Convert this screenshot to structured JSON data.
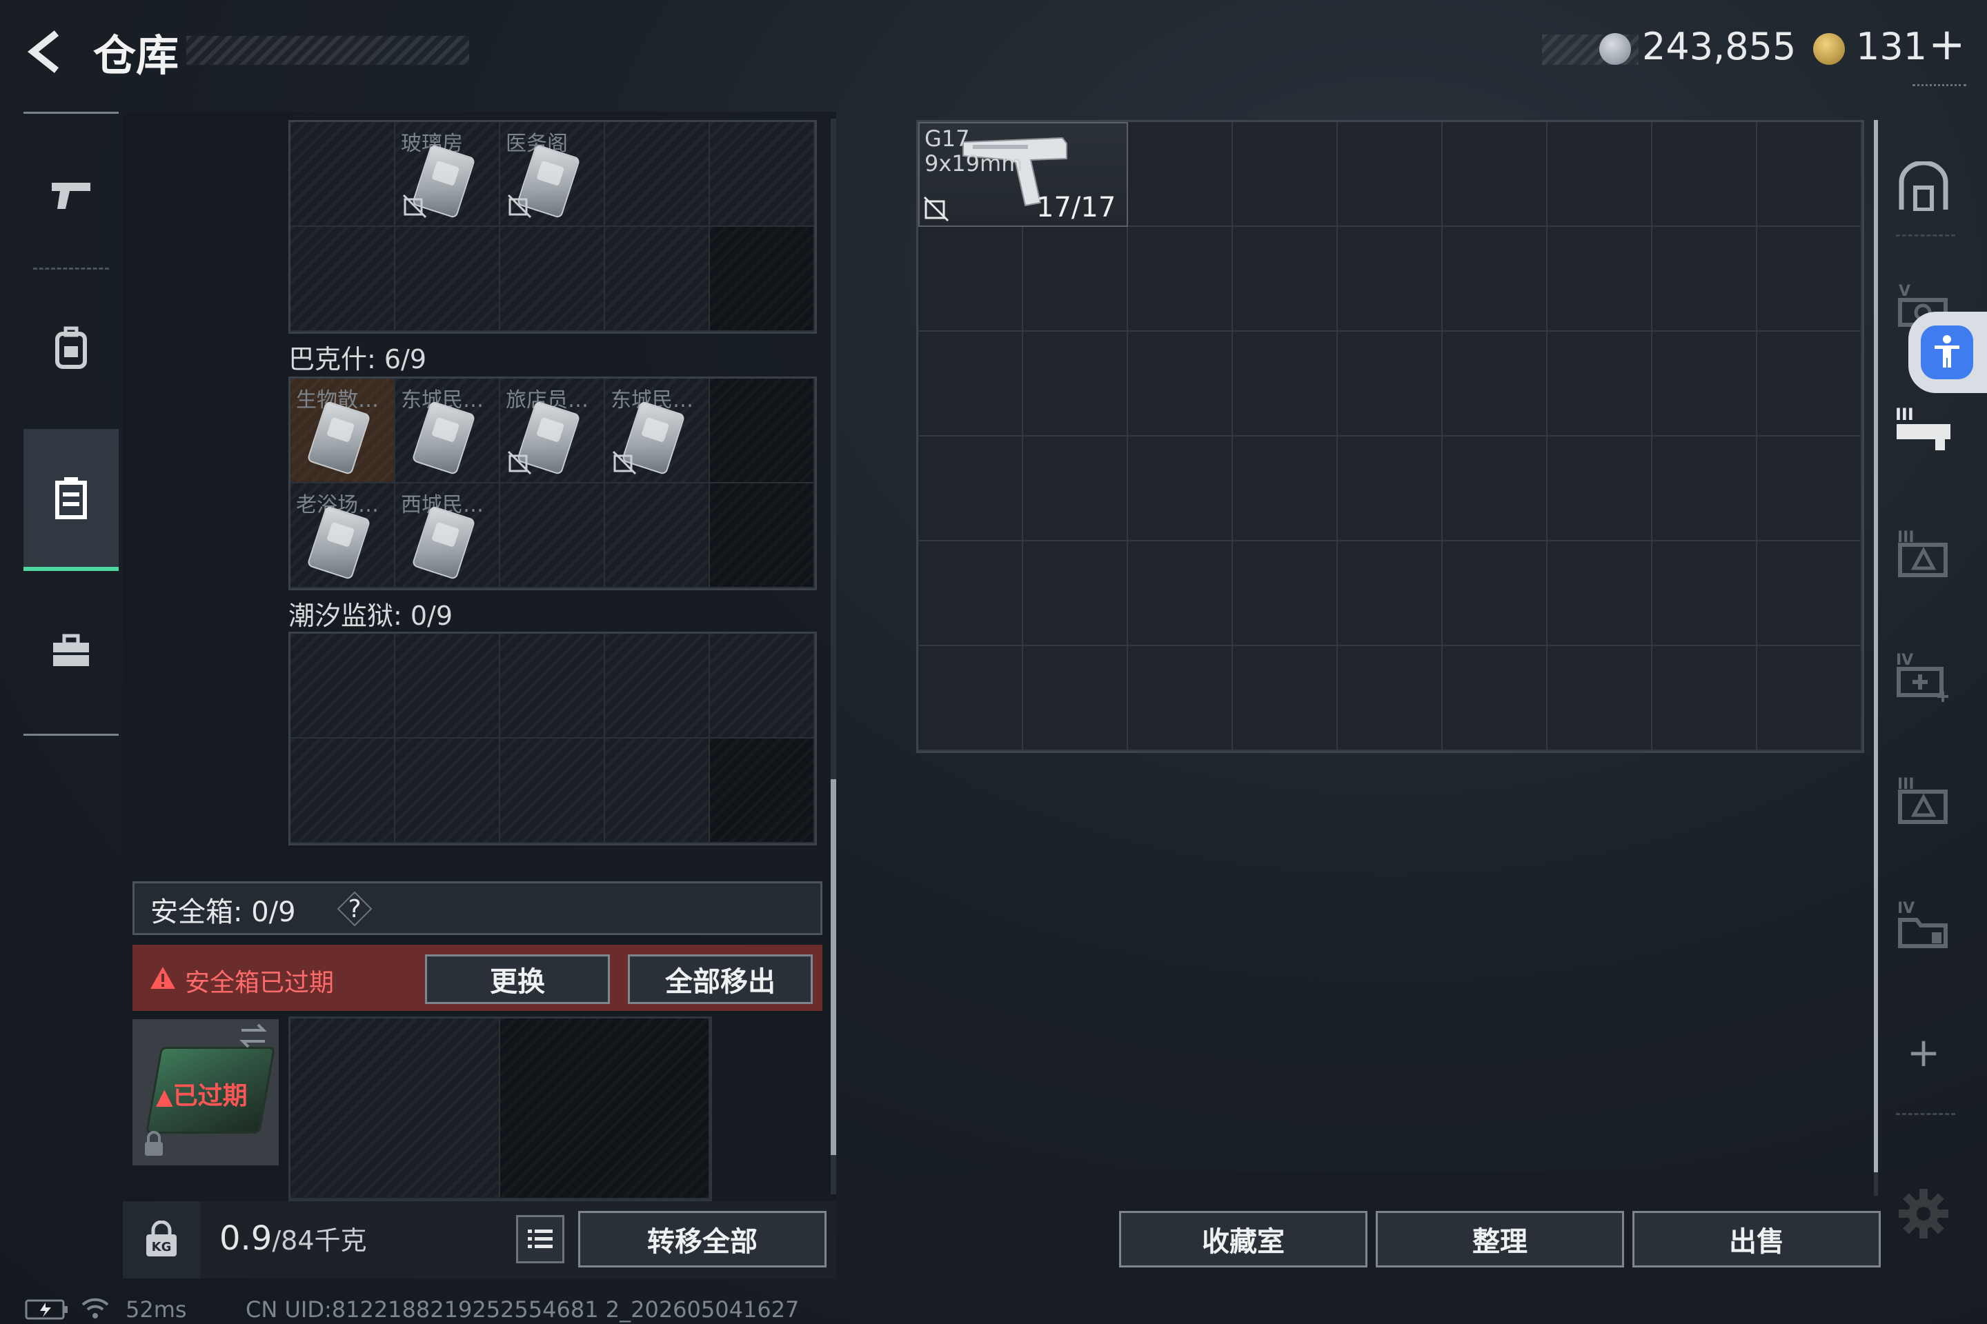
{
  "header": {
    "title": "仓库",
    "currency_silver": "243,855",
    "currency_gold": "131",
    "plus_symbol": "+"
  },
  "left_nav": {
    "items": [
      {
        "icon": "pistol-icon"
      },
      {
        "icon": "backpack-icon"
      },
      {
        "icon": "chest-rig-icon",
        "active": true
      },
      {
        "icon": "toolbox-icon"
      }
    ]
  },
  "containers": {
    "top_container": {
      "cards": [
        "玻璃房",
        "医务阁"
      ]
    },
    "bakeshi": {
      "label": "巴克什: 6/9",
      "cards": [
        "生物散…",
        "东城民…",
        "旅店员…",
        "东城民…",
        "老浴场…",
        "西城民…"
      ]
    },
    "tide_prison": {
      "label": "潮汐监狱: 0/9"
    }
  },
  "safebox": {
    "label": "安全箱:",
    "count": "0/9",
    "help": "?",
    "warning": "安全箱已过期",
    "replace_button": "更换",
    "move_all_button": "全部移出",
    "thumb_status": "已过期"
  },
  "bottom_left": {
    "weight_value": "0.9",
    "weight_unit": "/84千克",
    "transfer_all_button": "转移全部"
  },
  "stash": {
    "item": {
      "name": "G17",
      "caliber": "9x19mm",
      "ammo": "17/17"
    }
  },
  "bottom_right": {
    "collection_button": "收藏室",
    "sort_button": "整理",
    "sell_button": "出售"
  },
  "right_nav": {
    "items": [
      {
        "icon": "stash-main-icon"
      },
      {
        "icon": "stash-tab-v-icon",
        "label": "V"
      },
      {
        "icon": "stash-tab-iii-icon",
        "label": "III"
      },
      {
        "icon": "stash-tab-iii-warning-icon",
        "label": "III"
      },
      {
        "icon": "stash-tab-iv-medical-icon",
        "label": "IV"
      },
      {
        "icon": "stash-tab-iii-warning2-icon",
        "label": "III"
      },
      {
        "icon": "stash-tab-iv-folder-icon",
        "label": "IV"
      }
    ],
    "add": "+"
  },
  "status_bar": {
    "ping": "52ms",
    "uid": "CN UID:8122188219252554681 2_202605041627"
  },
  "colors": {
    "accent_green": "#4ed7a0",
    "warning_red": "#ff6b6b",
    "accessibility_blue": "#3f7cf0"
  }
}
